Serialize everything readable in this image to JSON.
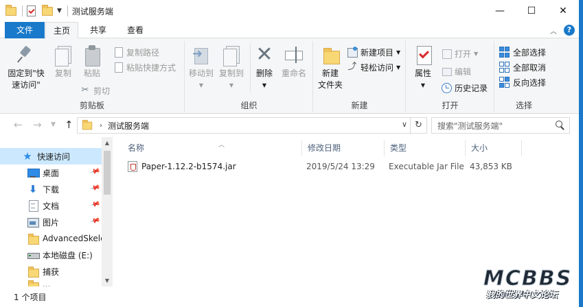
{
  "window": {
    "title": "测试服务端",
    "controls": {
      "minimize": "—",
      "maximize": "☐",
      "close": "✕"
    }
  },
  "tabs": [
    {
      "label": "文件"
    },
    {
      "label": "主页"
    },
    {
      "label": "共享"
    },
    {
      "label": "查看"
    }
  ],
  "help_glyph": "?",
  "ribbon": {
    "clipboard": {
      "label": "剪贴板",
      "pin_label": "固定到\"快\n速访问\"",
      "pin_label_line1": "固定到\"快",
      "pin_label_line2": "速访问\"",
      "copy": "复制",
      "paste": "粘贴",
      "copy_path": "复制路径",
      "paste_shortcut": "粘贴快捷方式",
      "cut": "剪切"
    },
    "organize": {
      "label": "组织",
      "move_to": "移动到",
      "copy_to": "复制到",
      "delete": "删除",
      "rename": "重命名"
    },
    "new": {
      "label": "新建",
      "new_folder_line1": "新建",
      "new_folder_line2": "文件夹",
      "new_item": "新建项目",
      "easy_access": "轻松访问"
    },
    "open": {
      "label": "打开",
      "properties": "属性",
      "open": "打开",
      "edit": "编辑",
      "history": "历史记录"
    },
    "select": {
      "label": "选择",
      "select_all": "全部选择",
      "select_none": "全部取消",
      "invert": "反向选择"
    }
  },
  "address": {
    "path": "测试服务端",
    "search_placeholder": "搜索\"测试服务端\""
  },
  "nav_pane": {
    "items": [
      {
        "label": "快速访问",
        "icon": "star-icon",
        "pinned": false
      },
      {
        "label": "桌面",
        "icon": "desktop-icon",
        "pinned": true
      },
      {
        "label": "下载",
        "icon": "download-icon",
        "pinned": true
      },
      {
        "label": "文档",
        "icon": "documents-icon",
        "pinned": true
      },
      {
        "label": "图片",
        "icon": "pictures-icon",
        "pinned": true
      },
      {
        "label": "AdvancedSkele",
        "icon": "folder-icon",
        "pinned": false
      },
      {
        "label": "本地磁盘 (E:)",
        "icon": "drive-icon",
        "pinned": false
      },
      {
        "label": "捕获",
        "icon": "folder-icon",
        "pinned": false
      },
      {
        "label": "...",
        "icon": "folder-icon",
        "pinned": false
      }
    ]
  },
  "columns": {
    "name": "名称",
    "modified": "修改日期",
    "type": "类型",
    "size": "大小"
  },
  "files": [
    {
      "name": "Paper-1.12.2-b1574.jar",
      "modified": "2019/5/24 13:29",
      "type": "Executable Jar File",
      "size": "43,853 KB"
    }
  ],
  "status": {
    "item_count": "1 个项目"
  },
  "watermark": {
    "top": "MCBBS",
    "bottom": "我的世界中文论坛"
  },
  "colors": {
    "accent": "#1979ca",
    "selection": "#cce8ff"
  }
}
